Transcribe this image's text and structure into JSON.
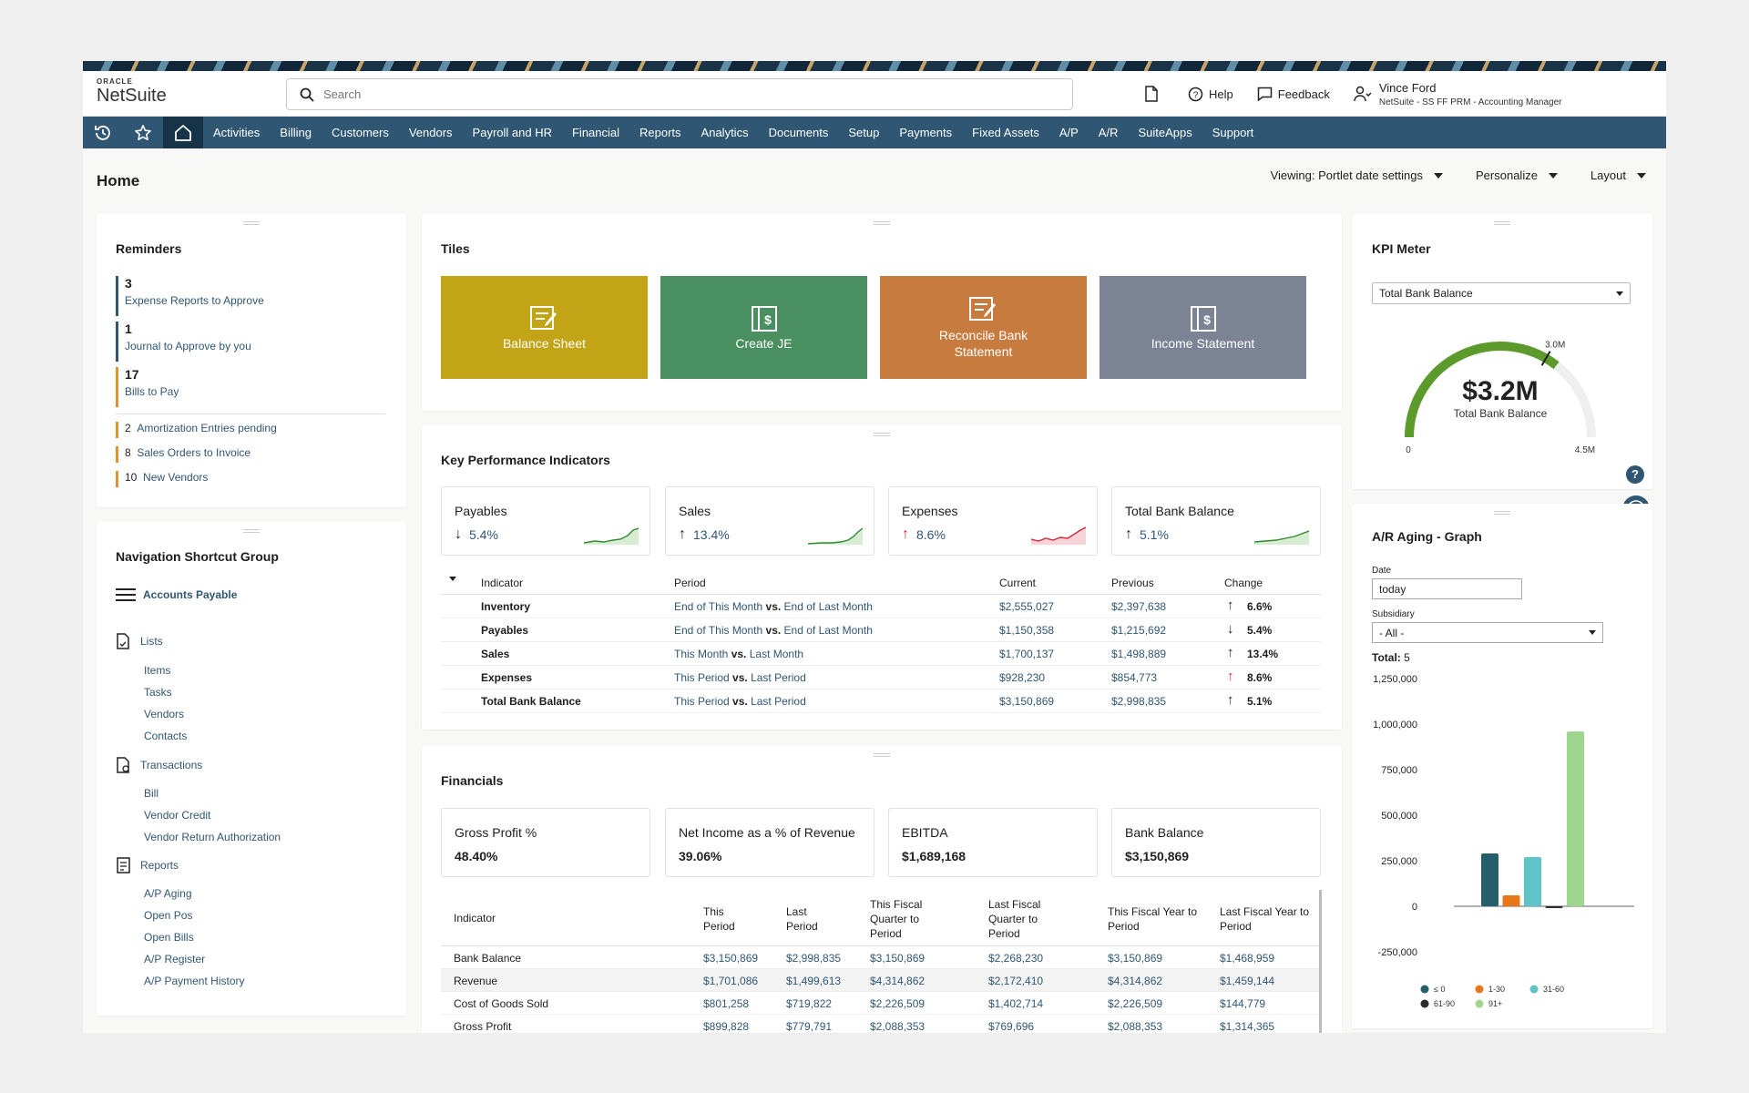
{
  "brand": {
    "oracle": "ORACLE",
    "product": "NetSuite"
  },
  "search": {
    "placeholder": "Search"
  },
  "header": {
    "help": "Help",
    "feedback": "Feedback",
    "user_name": "Vince Ford",
    "user_role": "NetSuite - SS FF PRM - Accounting Manager"
  },
  "nav": {
    "items": [
      "Activities",
      "Billing",
      "Customers",
      "Vendors",
      "Payroll and HR",
      "Financial",
      "Reports",
      "Analytics",
      "Documents",
      "Setup",
      "Payments",
      "Fixed Assets",
      "A/P",
      "A/R",
      "SuiteApps",
      "Support"
    ]
  },
  "page": {
    "title": "Home",
    "viewing": "Viewing: Portlet date settings",
    "personalize": "Personalize",
    "layout": "Layout"
  },
  "reminders": {
    "title": "Reminders",
    "major": [
      {
        "count": "3",
        "label": "Expense Reports to Approve",
        "color": "#2f5673"
      },
      {
        "count": "1",
        "label": "Journal to Approve by you",
        "color": "#2f5673"
      },
      {
        "count": "17",
        "label": "Bills to Pay",
        "color": "#e8902c"
      }
    ],
    "minor": [
      {
        "count": "2",
        "label": "Amortization Entries pending"
      },
      {
        "count": "8",
        "label": "Sales Orders to Invoice"
      },
      {
        "count": "10",
        "label": "New Vendors"
      }
    ]
  },
  "navgroup": {
    "title": "Navigation Shortcut Group",
    "head": "Accounts Payable",
    "sections": [
      {
        "label": "Lists",
        "items": [
          "Items",
          "Tasks",
          "Vendors",
          "Contacts"
        ]
      },
      {
        "label": "Transactions",
        "items": [
          "Bill",
          "Vendor Credit",
          "Vendor Return Authorization"
        ]
      },
      {
        "label": "Reports",
        "items": [
          "A/P Aging",
          "Open Pos",
          "Open Bills",
          "A/P Register",
          "A/P Payment History"
        ]
      }
    ]
  },
  "tiles": {
    "title": "Tiles",
    "items": [
      {
        "label": "Balance Sheet",
        "color": "#c2a416"
      },
      {
        "label": "Create JE",
        "color": "#4a8f5f"
      },
      {
        "label": "Reconcile Bank Statement",
        "color": "#c77b3e"
      },
      {
        "label": "Income Statement",
        "color": "#7b8394"
      }
    ]
  },
  "kpi": {
    "title": "Key Performance Indicators",
    "boxes": [
      {
        "label": "Payables",
        "arrow": "↓",
        "value": "5.4%",
        "color": "#2f8a2f"
      },
      {
        "label": "Sales",
        "arrow": "↑",
        "value": "13.4%",
        "color": "#2f8a2f"
      },
      {
        "label": "Expenses",
        "arrow": "↑",
        "value": "8.6%",
        "color": "#d6283a"
      },
      {
        "label": "Total Bank Balance",
        "arrow": "↑",
        "value": "5.1%",
        "color": "#2f8a2f"
      }
    ],
    "headers": [
      "Indicator",
      "Period",
      "Current",
      "Previous",
      "Change"
    ],
    "vs": "vs.",
    "rows": [
      {
        "name": "Inventory",
        "p1": "End of This Month",
        "p2": "End of Last Month",
        "current": "$2,555,027",
        "previous": "$2,397,638",
        "arrow": "↑",
        "change": "6.6%"
      },
      {
        "name": "Payables",
        "p1": "End of This Month",
        "p2": "End of Last Month",
        "current": "$1,150,358",
        "previous": "$1,215,692",
        "arrow": "↓",
        "change": "5.4%"
      },
      {
        "name": "Sales",
        "p1": "This Month",
        "p2": "Last Month",
        "current": "$1,700,137",
        "previous": "$1,498,889",
        "arrow": "↑",
        "change": "13.4%"
      },
      {
        "name": "Expenses",
        "p1": "This Period",
        "p2": "Last Period",
        "current": "$928,230",
        "previous": "$854,773",
        "arrow": "↑",
        "change": "8.6%"
      },
      {
        "name": "Total Bank Balance",
        "p1": "This Period",
        "p2": "Last Period",
        "current": "$3,150,869",
        "previous": "$2,998,835",
        "arrow": "↑",
        "change": "5.1%"
      }
    ]
  },
  "financials": {
    "title": "Financials",
    "boxes": [
      {
        "label": "Gross Profit %",
        "value": "48.40%"
      },
      {
        "label": "Net Income as a % of Revenue",
        "value": "39.06%"
      },
      {
        "label": "EBITDA",
        "value": "$1,689,168"
      },
      {
        "label": "Bank Balance",
        "value": "$3,150,869"
      }
    ],
    "headers": [
      "Indicator",
      "This Period",
      "Last Period",
      "This Fiscal Quarter to Period",
      "Last Fiscal Quarter to Period",
      "This Fiscal Year to Period",
      "Last Fiscal Year to Period"
    ],
    "rows": [
      [
        "Bank Balance",
        "$3,150,869",
        "$2,998,835",
        "$3,150,869",
        "$2,268,230",
        "$3,150,869",
        "$1,468,959"
      ],
      [
        "Revenue",
        "$1,701,086",
        "$1,499,613",
        "$4,314,862",
        "$2,172,410",
        "$4,314,862",
        "$1,459,144"
      ],
      [
        "Cost of Goods Sold",
        "$801,258",
        "$719,822",
        "$2,226,509",
        "$1,402,714",
        "$2,226,509",
        "$144,779"
      ],
      [
        "Gross Profit",
        "$899,828",
        "$779,791",
        "$2,088,353",
        "$769,696",
        "$2,088,353",
        "$1,314,365"
      ]
    ]
  },
  "kpimeter": {
    "title": "KPI Meter",
    "select": "Total Bank Balance",
    "value": "$3.2M",
    "label": "Total Bank Balance",
    "min": "0",
    "max": "4.5M",
    "target": "3.0M",
    "fraction": 0.711,
    "target_fraction": 0.667,
    "color": "#5c9a2c"
  },
  "aging": {
    "title": "A/R Aging - Graph",
    "date_label": "Date",
    "date_value": "today",
    "subsidiary_label": "Subsidiary",
    "subsidiary_value": "- All -",
    "total_label": "Total:",
    "total_value": "5"
  },
  "chart_data": {
    "type": "bar",
    "categories": [
      "≤ 0",
      "1-30",
      "31-60",
      "61-90",
      "91+"
    ],
    "values": [
      290000,
      60000,
      270000,
      -10000,
      960000
    ],
    "colors": [
      "#275e6b",
      "#e8771b",
      "#5fc4c8",
      "#2b2b2b",
      "#9fd68f"
    ],
    "yticks": [
      "1,250,000",
      "1,000,000",
      "750,000",
      "500,000",
      "250,000",
      "0",
      "-250,000"
    ],
    "ylim": [
      -250000,
      1250000
    ]
  }
}
